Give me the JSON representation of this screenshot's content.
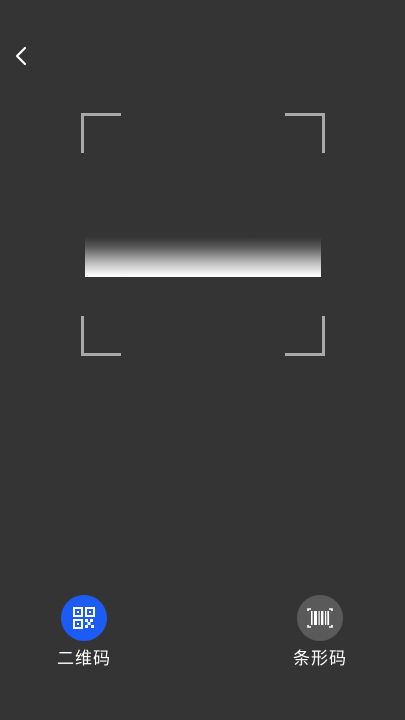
{
  "header": {
    "back_icon": "chevron-left-icon"
  },
  "scanner": {
    "frame": "scan-frame",
    "line": "scan-line"
  },
  "modes": [
    {
      "label": "二维码",
      "icon": "qr-code-icon",
      "active": true,
      "color": "#1d5bf5"
    },
    {
      "label": "条形码",
      "icon": "barcode-icon",
      "active": false,
      "color": "#5a5a5a"
    }
  ],
  "colors": {
    "background": "#343434",
    "frame_corner": "#a9a9a9",
    "accent": "#1d5bf5"
  }
}
